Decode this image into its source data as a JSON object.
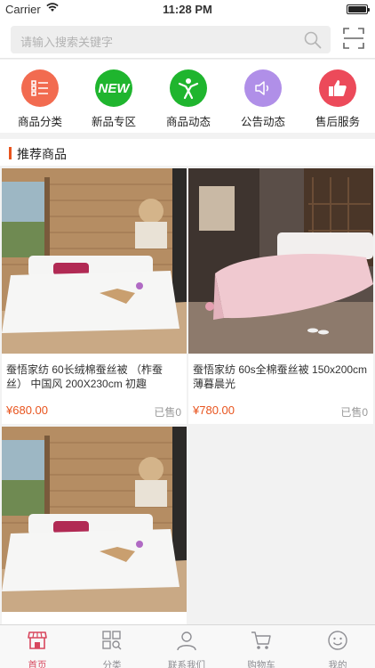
{
  "status": {
    "carrier": "Carrier",
    "time": "11:28 PM"
  },
  "search": {
    "placeholder": "请输入搜索关键字"
  },
  "categories": [
    {
      "label": "商品分类",
      "icon": "list-icon",
      "color": "#f26b50"
    },
    {
      "label": "新品专区",
      "icon": "new-badge-icon",
      "badge": "NEW",
      "color": "#1fb52e"
    },
    {
      "label": "商品动态",
      "icon": "person-activity-icon",
      "color": "#1fb52e"
    },
    {
      "label": "公告动态",
      "icon": "speaker-icon",
      "color": "#b08fe8"
    },
    {
      "label": "售后服务",
      "icon": "thumbs-up-icon",
      "color": "#ec4a5a"
    }
  ],
  "recommend": {
    "title": "推荐商品"
  },
  "products": [
    {
      "name": "蚕悟家纺  60长绒棉蚕丝被 （柞蚕丝） 中国风 200X230cm 初趣",
      "price": "¥680.00",
      "sold": "已售0",
      "image": "white-bedding-photo"
    },
    {
      "name": "蚕悟家纺  60s全棉蚕丝被 150x200cm 薄暮晨光",
      "price": "¥780.00",
      "sold": "已售0",
      "image": "pink-bedding-photo"
    },
    {
      "name": "",
      "price": "",
      "sold": "",
      "image": "white-bedding-photo"
    }
  ],
  "tabbar": [
    {
      "label": "首页",
      "icon": "shop-icon",
      "active": true
    },
    {
      "label": "分类",
      "icon": "grid-search-icon"
    },
    {
      "label": "联系我们",
      "icon": "person-icon"
    },
    {
      "label": "购物车",
      "icon": "cart-icon"
    },
    {
      "label": "我的",
      "icon": "smiley-icon"
    }
  ],
  "colors": {
    "accent": "#e8541e",
    "tab_active": "#d8475e"
  }
}
